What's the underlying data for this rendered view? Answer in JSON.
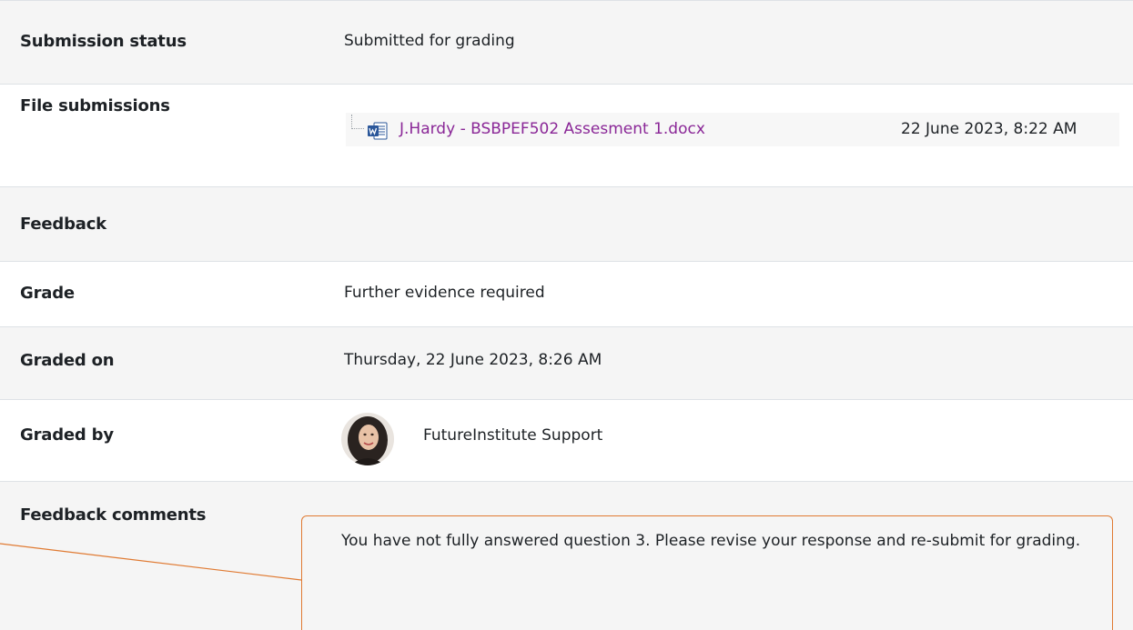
{
  "submission": {
    "status_label": "Submission status",
    "status_value": "Submitted for grading",
    "files_label": "File submissions",
    "file": {
      "icon": "word-doc-icon",
      "name": "J.Hardy - BSBPEF502 Assesment 1.docx",
      "date": "22 June 2023, 8:22 AM"
    }
  },
  "feedback": {
    "heading": "Feedback",
    "grade_label": "Grade",
    "grade_value": "Further evidence required",
    "graded_on_label": "Graded on",
    "graded_on_value": "Thursday, 22 June 2023, 8:26 AM",
    "graded_by_label": "Graded by",
    "graded_by_value": "FutureInstitute Support",
    "comments_label": "Feedback comments",
    "comments_value": "You have not fully answered question 3. Please revise your response and re-submit for grading."
  },
  "colors": {
    "link": "#8a2797",
    "callout_border": "#e07a32",
    "row_shade": "#f5f5f5"
  }
}
